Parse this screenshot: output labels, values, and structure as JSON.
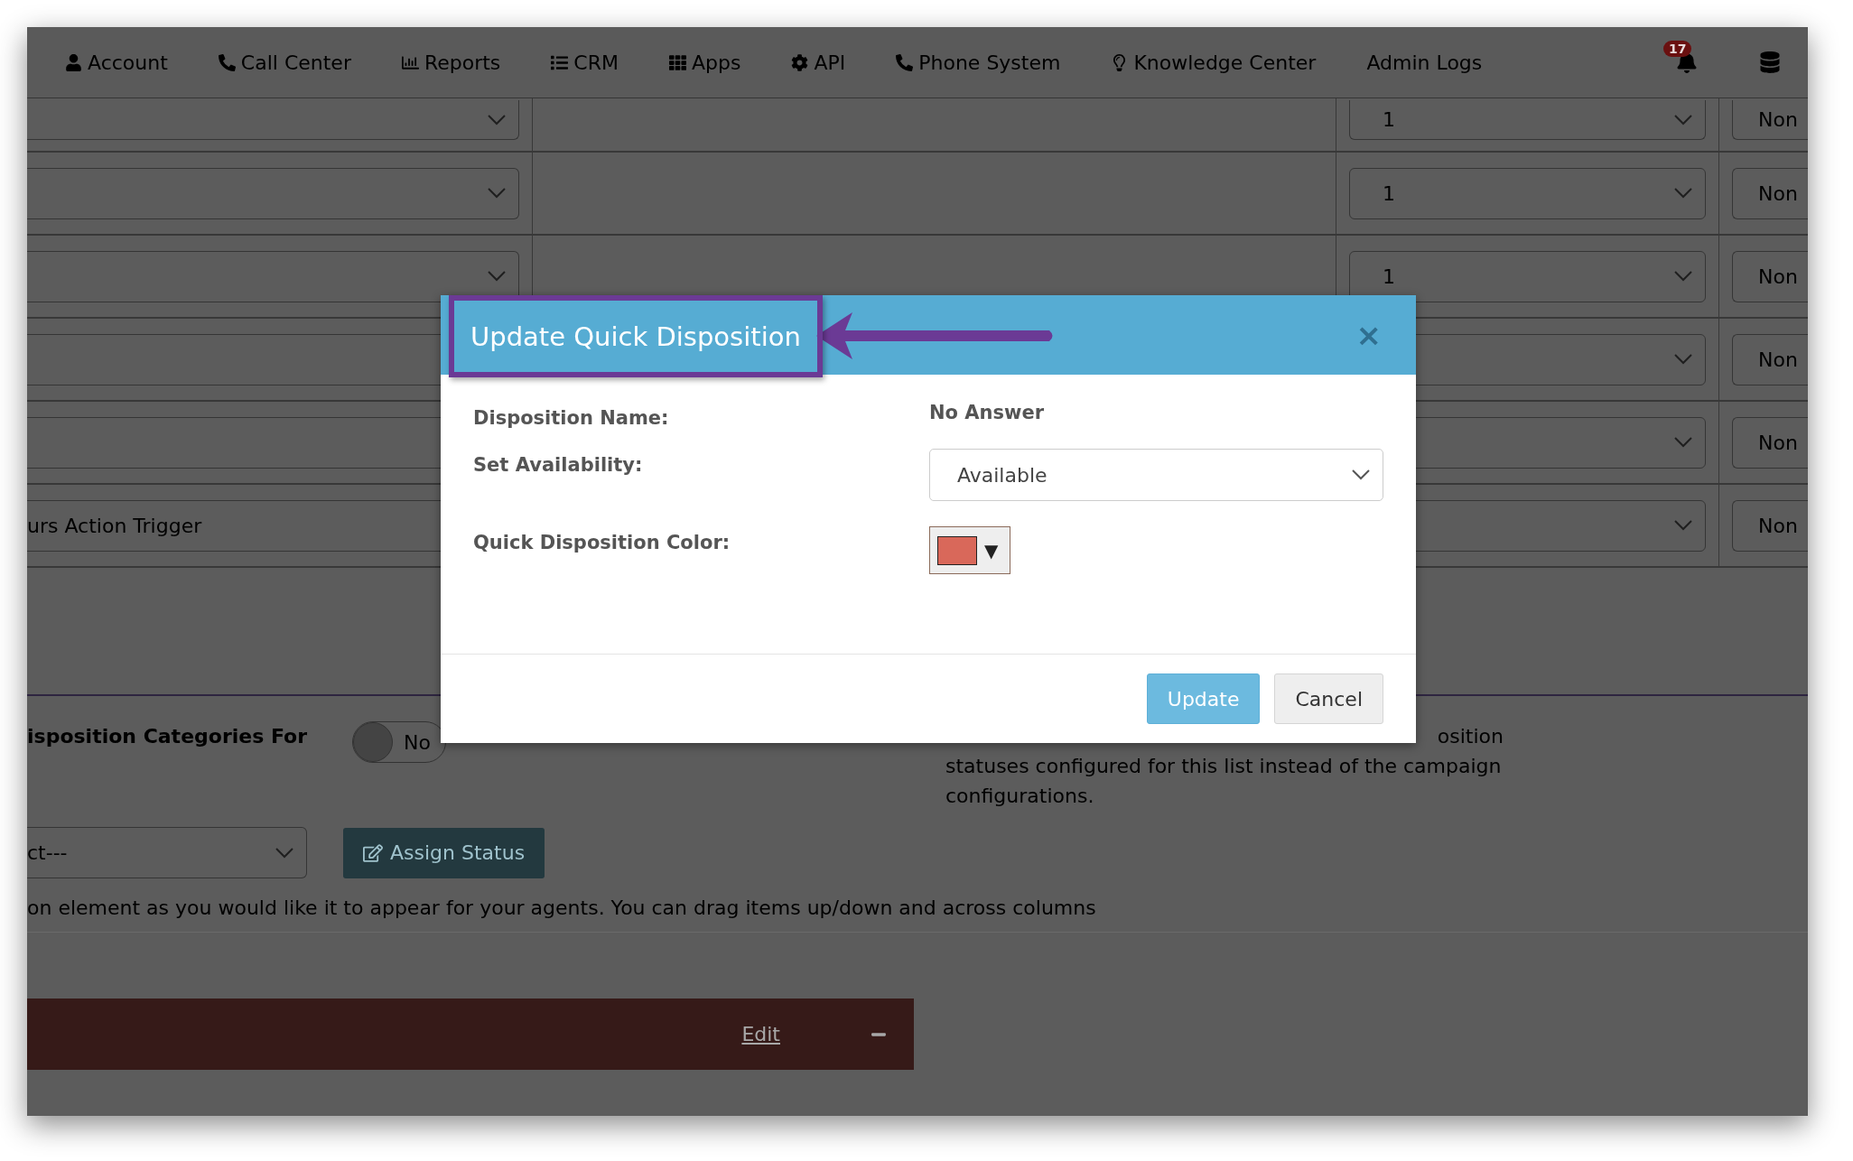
{
  "nav": {
    "items": [
      {
        "label": "Account"
      },
      {
        "label": "Call Center"
      },
      {
        "label": "Reports"
      },
      {
        "label": "CRM"
      },
      {
        "label": "Apps"
      },
      {
        "label": "API"
      },
      {
        "label": "Phone System"
      },
      {
        "label": "Knowledge Center"
      },
      {
        "label": "Admin Logs"
      }
    ],
    "notifications": {
      "count": "17"
    }
  },
  "table": {
    "rows": [
      {
        "column_3": "1",
        "column_4": "Non"
      },
      {
        "column_3": "1",
        "column_4": "Non"
      },
      {
        "column_3": "1",
        "column_4": "Non"
      },
      {
        "column_4": "Non"
      },
      {
        "column_4": "Non"
      },
      {
        "column_1": "urs Action Trigger",
        "column_4": "Non"
      }
    ]
  },
  "settings": {
    "label": "isposition Categories For",
    "toggle": {
      "label": "No",
      "on": false
    },
    "description": [
      "osition",
      "statuses configured for this list instead of the campaign",
      "configurations."
    ]
  },
  "assign": {
    "select": "ct---",
    "button": "Assign Status"
  },
  "instructions": "on element as you would like it to appear for your agents. You can drag items up/down and across columns",
  "panel": {
    "link": "Edit"
  },
  "modal": {
    "title": "Update Quick Disposition",
    "close": "×",
    "fields": [
      {
        "kind": "text",
        "label": "Disposition Name:",
        "value": "No Answer"
      },
      {
        "kind": "select",
        "label": "Set Availability:",
        "value": "Available"
      },
      {
        "kind": "color",
        "label": "Quick Disposition Color:",
        "color": "#d9685a",
        "caret": "▼"
      }
    ],
    "buttons": [
      {
        "label": "Update",
        "kind": "primary"
      },
      {
        "label": "Cancel",
        "kind": "default"
      }
    ]
  }
}
